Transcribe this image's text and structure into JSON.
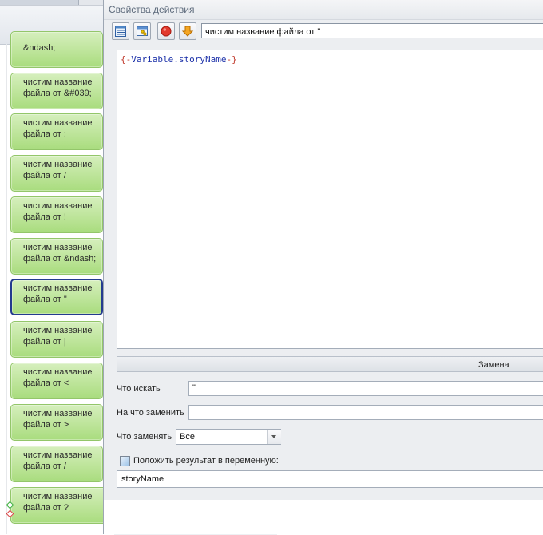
{
  "dialog": {
    "title": "Свойства действия",
    "action_name": "чистим название файла от \"",
    "editor": {
      "open_brace": "{-",
      "variable": "Variable.storyName",
      "close_brace": "-}"
    },
    "replace_section": {
      "header": "Замена",
      "find_label": "Что искать",
      "find_value": "\"",
      "replace_label": "На что заменить",
      "replace_value": "",
      "mode_label": "Что заменять",
      "mode_value": "Все",
      "save_label": "Положить результат в переменную:",
      "result_variable": "storyName"
    }
  },
  "flow_blocks": [
    {
      "text": "&ndash;"
    },
    {
      "text": "чистим название\nфайла от &#039;"
    },
    {
      "text": "чистим название\nфайла от :"
    },
    {
      "text": "чистим название\nфайла от /"
    },
    {
      "text": "чистим название\nфайла от !"
    },
    {
      "text": "чистим название\nфайла от &ndash;"
    },
    {
      "text": "чистим название\nфайла от \"",
      "selected": true
    },
    {
      "text": "чистим название\nфайла от |"
    },
    {
      "text": "чистим название\nфайла от <"
    },
    {
      "text": "чистим название\nфайла от >"
    },
    {
      "text": "чистим название\nфайла от /"
    },
    {
      "text": "чистим название\nфайла от ?"
    }
  ],
  "icons": {
    "toolbar": [
      "table-icon",
      "properties-icon",
      "record-icon",
      "arrow-down-icon"
    ],
    "block": "pen-icon"
  },
  "colors": {
    "block_fill_top": "#d6efbd",
    "block_fill_bottom": "#a9dc7e",
    "selected_border": "#243b8f",
    "brace": "#c0392b",
    "variable": "#1a2fa8"
  }
}
